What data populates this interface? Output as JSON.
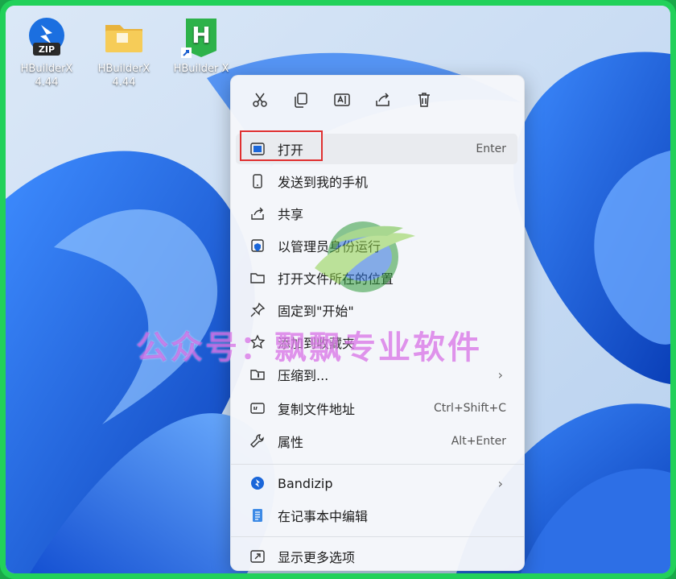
{
  "desktop": {
    "icons": [
      {
        "name": "HBuilderX",
        "version": "4.44",
        "icon": "zip-archive-icon"
      },
      {
        "name": "HBuilderX",
        "version": "4.44",
        "icon": "folder-icon"
      },
      {
        "name": "HBuilder X",
        "version": "",
        "icon": "hbuilder-shortcut-icon"
      }
    ]
  },
  "context_menu": {
    "toolbar": [
      "cut-icon",
      "copy-icon",
      "rename-icon",
      "share-icon",
      "delete-icon"
    ],
    "items": [
      {
        "label": "打开",
        "shortcut": "Enter",
        "icon": "open-window-icon"
      },
      {
        "label": "发送到我的手机",
        "icon": "phone-icon"
      },
      {
        "label": "共享",
        "icon": "share-icon"
      },
      {
        "label": "以管理员身份运行",
        "icon": "shield-icon"
      },
      {
        "label": "打开文件所在的位置",
        "icon": "folder-outline-icon"
      },
      {
        "label": "固定到\"开始\"",
        "icon": "pin-icon"
      },
      {
        "label": "添加到收藏夹",
        "icon": "star-icon"
      },
      {
        "label": "压缩到...",
        "icon": "archive-folder-icon"
      },
      {
        "label": "复制文件地址",
        "shortcut": "Ctrl+Shift+C",
        "icon": "copy-path-icon"
      },
      {
        "label": "属性",
        "shortcut": "Alt+Enter",
        "icon": "wrench-icon"
      },
      {
        "label": "Bandizip",
        "icon": "bandizip-icon"
      },
      {
        "label": "在记事本中编辑",
        "icon": "notepad-icon"
      },
      {
        "label": "显示更多选项",
        "icon": "more-options-icon"
      }
    ]
  },
  "watermark": {
    "text": "公众号：飘飘专业软件"
  },
  "colors": {
    "frame": "#22d15a",
    "highlight_box": "#e03030",
    "watermark": "#c83cdc"
  }
}
